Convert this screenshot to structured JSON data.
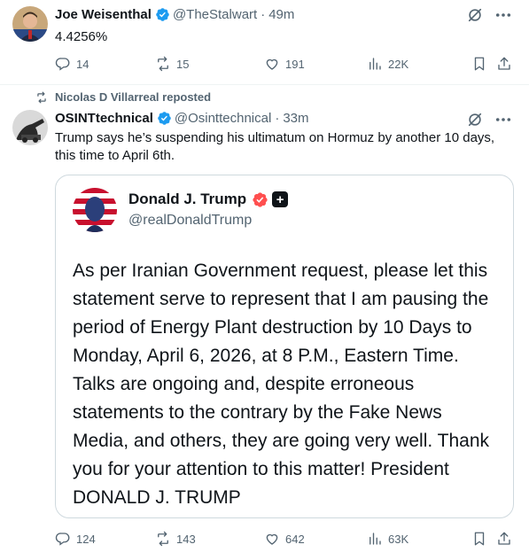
{
  "tweet1": {
    "name": "Joe Weisenthal",
    "handle": "@TheStalwart",
    "time": "49m",
    "dot": "·",
    "text": "4.4256%",
    "stats": {
      "replies": "14",
      "reposts": "15",
      "likes": "191",
      "views": "22K"
    }
  },
  "tweet2": {
    "reposted_by": "Nicolas D Villarreal reposted",
    "name": "OSINTtechnical",
    "handle": "@Osinttechnical",
    "time": "33m",
    "dot": "·",
    "text": "Trump says he’s suspending his ultimatum on Hormuz by another 10 days, this time to April 6th.",
    "stats": {
      "replies": "124",
      "reposts": "143",
      "likes": "642",
      "views": "63K"
    }
  },
  "quote": {
    "name": "Donald J. Trump",
    "handle": "@realDonaldTrump",
    "plus": "+",
    "text": "As per Iranian Government request, please let this statement serve to represent that I am pausing the period of Energy Plant destruction by 10 Days to Monday, April 6, 2026, at 8 P.M., Eastern Time. Talks are ongoing and, despite erroneous statements to the contrary by the Fake News Media, and others, they are going very well. Thank you for your attention to this matter! President DONALD J. TRUMP"
  },
  "colors": {
    "verified_blue": "#1d9bf0",
    "truth_red": "#ff4f4f",
    "muted": "#536471",
    "border": "#cfd9de"
  },
  "icons": [
    "verified-badge-icon",
    "grok-icon",
    "more-icon",
    "reply-icon",
    "repost-icon",
    "like-icon",
    "views-icon",
    "bookmark-icon",
    "share-icon",
    "truth-verified-icon"
  ]
}
